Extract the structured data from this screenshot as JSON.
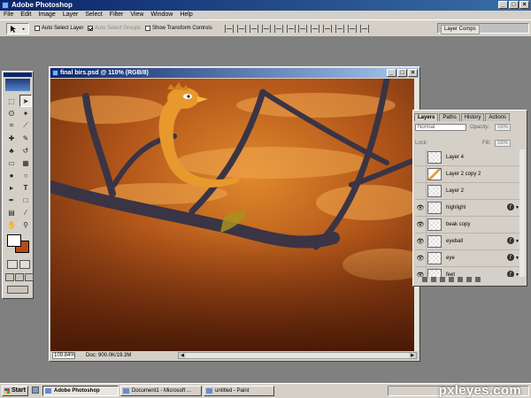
{
  "app": {
    "title": "Adobe Photoshop"
  },
  "menu": [
    "File",
    "Edit",
    "Image",
    "Layer",
    "Select",
    "Filter",
    "View",
    "Window",
    "Help"
  ],
  "options": {
    "auto_select_layer": "Auto Select Layer",
    "auto_select_groups": "Auto Select Groups",
    "show_transform": "Show Transform Controls",
    "palette_well_tab": "Layer Comps",
    "auto_select_layer_checked": false,
    "auto_select_groups_checked": true,
    "show_transform_checked": false
  },
  "document": {
    "title": "final birs.psd @ 110% (RGB/8)",
    "zoom": "109.84%",
    "doc_info": "Doc: 900.0K/19.3M"
  },
  "layers_panel": {
    "tabs": [
      "Layers",
      "Paths",
      "History",
      "Actions"
    ],
    "blend_mode": "Normal",
    "opacity_label": "Opacity:",
    "opacity_value": "100%",
    "lock_label": "Lock:",
    "fill_label": "Fill:",
    "fill_value": "100%",
    "layers": [
      {
        "name": "Layer 4",
        "visible": false,
        "fx": false
      },
      {
        "name": "Layer 2 copy 2",
        "visible": false,
        "fx": false
      },
      {
        "name": "Layer 2",
        "visible": false,
        "fx": false
      },
      {
        "name": "highlight",
        "visible": true,
        "fx": true
      },
      {
        "name": "beak copy",
        "visible": true,
        "fx": false
      },
      {
        "name": "eyeball",
        "visible": true,
        "fx": true
      },
      {
        "name": "eye",
        "visible": true,
        "fx": true
      },
      {
        "name": "feet",
        "visible": true,
        "fx": true
      }
    ]
  },
  "taskbar": {
    "start": "Start",
    "tasks": [
      "Adobe Photoshop",
      "Document1 - Microsoft ...",
      "untitled - Paint"
    ],
    "watermark": "pxleyes.com"
  },
  "colors": {
    "title_bar": "#0a246a",
    "chrome": "#d4d0c8",
    "foreground_color": "#ffffff",
    "background_color": "#b84a12"
  },
  "icons": {
    "tools": [
      "marquee-icon",
      "move-icon",
      "lasso-icon",
      "magic-wand-icon",
      "crop-icon",
      "slice-icon",
      "healing-brush-icon",
      "brush-icon",
      "clone-stamp-icon",
      "history-brush-icon",
      "eraser-icon",
      "gradient-icon",
      "blur-icon",
      "dodge-icon",
      "path-select-icon",
      "type-icon",
      "pen-icon",
      "shape-icon",
      "notes-icon",
      "eyedropper-icon",
      "hand-icon",
      "zoom-icon"
    ]
  }
}
